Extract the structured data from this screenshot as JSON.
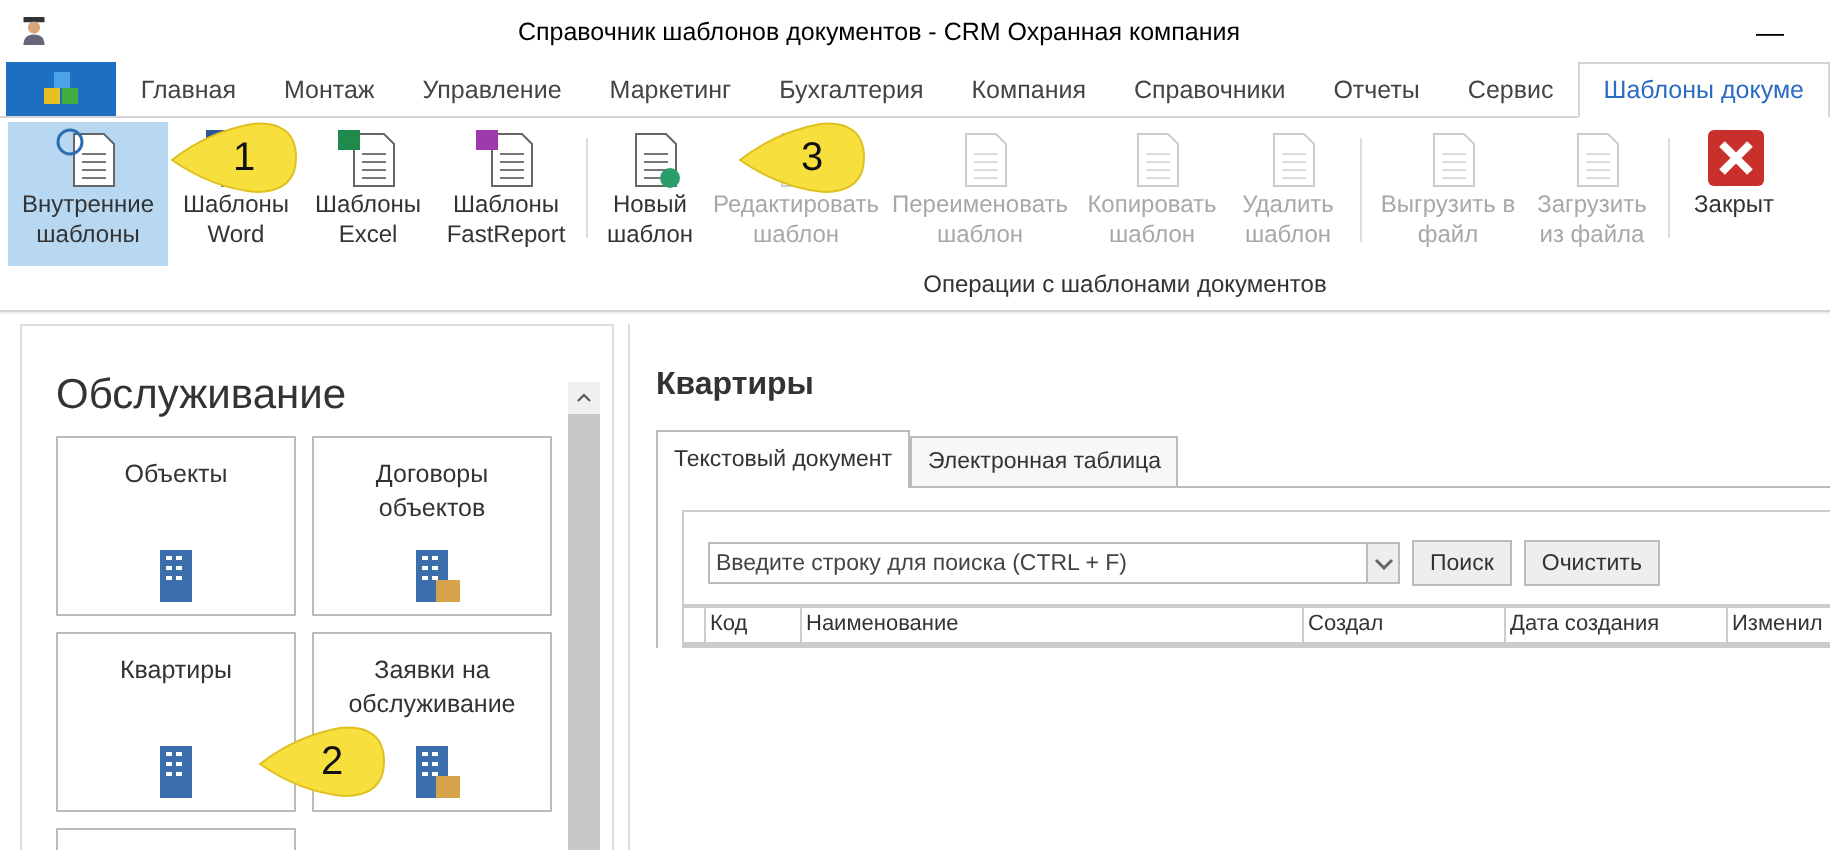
{
  "window": {
    "title": "Справочник шаблонов документов - CRM Охранная компания",
    "minimize": "—"
  },
  "ribbon_tabs": [
    {
      "label": "Главная",
      "selected": false
    },
    {
      "label": "Монтаж",
      "selected": false
    },
    {
      "label": "Управление",
      "selected": false
    },
    {
      "label": "Маркетинг",
      "selected": false
    },
    {
      "label": "Бухгалтерия",
      "selected": false
    },
    {
      "label": "Компания",
      "selected": false
    },
    {
      "label": "Справочники",
      "selected": false
    },
    {
      "label": "Отчеты",
      "selected": false
    },
    {
      "label": "Сервис",
      "selected": false
    },
    {
      "label": "Шаблоны докуме",
      "selected": true
    }
  ],
  "ribbon": {
    "sections": [
      {
        "buttons": [
          {
            "label": "Внутренние шаблоны",
            "selected": true,
            "disabled": false,
            "divider_before": false
          },
          {
            "label": "Шаблоны Word",
            "selected": false,
            "disabled": false,
            "divider_before": false
          },
          {
            "label": "Шаблоны Excel",
            "selected": false,
            "disabled": false,
            "divider_before": false
          },
          {
            "label": "Шаблоны FastReport",
            "selected": false,
            "disabled": false,
            "divider_before": false
          }
        ]
      },
      {
        "label": "Операции с шаблонами документов",
        "buttons": [
          {
            "label": "Новый шаблон",
            "selected": false,
            "disabled": false,
            "divider_before": false
          },
          {
            "label": "Редактировать шаблон",
            "selected": false,
            "disabled": true,
            "divider_before": false
          },
          {
            "label": "Переименовать шаблон",
            "selected": false,
            "disabled": true,
            "divider_before": false
          },
          {
            "label": "Копировать шаблон",
            "selected": false,
            "disabled": true,
            "divider_before": false
          },
          {
            "label": "Удалить шаблон",
            "selected": false,
            "disabled": true,
            "divider_before": false
          },
          {
            "label": "Выгрузить в файл",
            "selected": false,
            "disabled": true,
            "divider_before": true
          },
          {
            "label": "Загрузить из файла",
            "selected": false,
            "disabled": true,
            "divider_before": false
          }
        ]
      },
      {
        "buttons": [
          {
            "label": "Закрыт",
            "selected": false,
            "disabled": false,
            "divider_before": false
          }
        ]
      }
    ]
  },
  "sidebar": {
    "title": "Обслуживание",
    "tiles": [
      {
        "label": "Объекты"
      },
      {
        "label": "Договоры объектов"
      },
      {
        "label": "Квартиры"
      },
      {
        "label": "Заявки на обслуживание"
      }
    ]
  },
  "content": {
    "title": "Квартиры",
    "tabs": [
      {
        "label": "Текстовый документ",
        "selected": true
      },
      {
        "label": "Электронная таблица",
        "selected": false
      }
    ],
    "search": {
      "placeholder": "Введите строку для поиска (CTRL + F)"
    },
    "buttons": [
      "Поиск",
      "Очистить"
    ],
    "table": {
      "columns": [
        "Код",
        "Наименование",
        "Создал",
        "Дата создания",
        "Изменил"
      ]
    }
  },
  "callouts": [
    {
      "number": "1"
    },
    {
      "number": "2"
    },
    {
      "number": "3"
    }
  ]
}
